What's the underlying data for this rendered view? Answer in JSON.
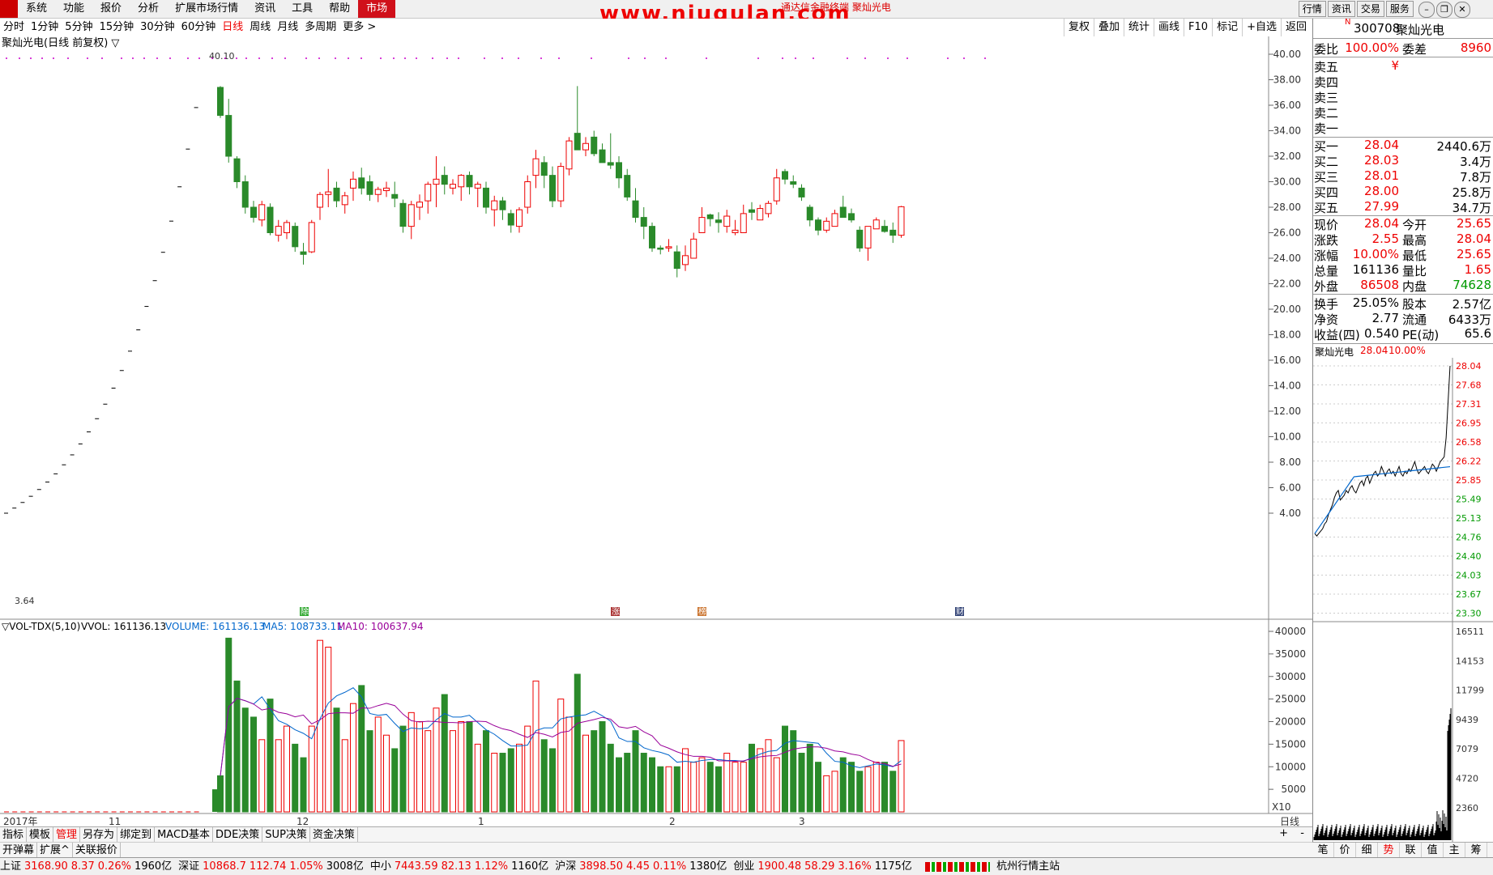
{
  "menu": {
    "items": [
      "系统",
      "功能",
      "报价",
      "分析",
      "扩展市场行情",
      "资讯",
      "工具",
      "帮助"
    ],
    "market_label": "市场"
  },
  "watermark": {
    "main": "www.niugulan.com",
    "sub": "通达信金融终端 聚灿光电"
  },
  "top_buttons": [
    "行情",
    "资讯",
    "交易",
    "服务"
  ],
  "period_bar": {
    "items": [
      "分时",
      "1分钟",
      "5分钟",
      "15分钟",
      "30分钟",
      "60分钟",
      "日线",
      "周线",
      "月线",
      "多周期",
      "更多 >"
    ],
    "selected": "日线"
  },
  "right_tools": [
    "复权",
    "叠加",
    "统计",
    "画线",
    "F10",
    "标记",
    "+自选",
    "返回"
  ],
  "chart": {
    "title": "聚灿光电(日线 前复权) ▽",
    "max_label": "40.10",
    "min_label": "3.64",
    "markers": [
      "除",
      "涨",
      "榜",
      "财"
    ],
    "volume_header": {
      "name": "▽VOL-TDX(5,10)",
      "vvol": "VVOL: 161136.13",
      "volume": "VOLUME: 161136.13",
      "ma5": "MA5: 108733.11",
      "ma10": "MA10: 100637.94"
    },
    "x_labels": [
      "2017年",
      "11",
      "12",
      "1",
      "2",
      "3"
    ],
    "x10": "X10",
    "period_label": "日线",
    "price_ticks": [
      "40.00",
      "38.00",
      "36.00",
      "34.00",
      "32.00",
      "30.00",
      "28.00",
      "26.00",
      "24.00",
      "22.00",
      "20.00",
      "18.00",
      "16.00",
      "14.00",
      "12.00",
      "10.00",
      "8.00",
      "6.00",
      "4.00"
    ],
    "volume_ticks": [
      "40000",
      "35000",
      "30000",
      "25000",
      "20000",
      "15000",
      "10000",
      "5000"
    ]
  },
  "chart_data": {
    "type": "bar",
    "title": "聚灿光电(日线 前复权)",
    "ylim": [
      3.0,
      41.0
    ],
    "ohlc_recent": [
      [
        37.4,
        37.5,
        35.0,
        35.2
      ],
      [
        35.2,
        36.5,
        31.5,
        32.0
      ],
      [
        31.8,
        32.0,
        29.5,
        30.0
      ],
      [
        30.0,
        30.5,
        27.5,
        28.0
      ],
      [
        28.0,
        28.5,
        26.8,
        27.2
      ],
      [
        27.0,
        28.5,
        26.5,
        28.2
      ],
      [
        28.0,
        28.3,
        25.8,
        26.0
      ],
      [
        25.8,
        27.0,
        25.3,
        26.5
      ],
      [
        26.0,
        27.0,
        25.5,
        26.8
      ],
      [
        26.5,
        26.8,
        24.5,
        24.9
      ],
      [
        24.5,
        25.2,
        23.5,
        24.3
      ],
      [
        24.5,
        27.0,
        24.4,
        26.8
      ],
      [
        28.0,
        29.2,
        27.0,
        29.0
      ],
      [
        29.0,
        31.0,
        28.0,
        29.2
      ],
      [
        29.5,
        30.0,
        28.0,
        28.5
      ],
      [
        28.2,
        29.2,
        27.5,
        28.9
      ],
      [
        29.5,
        30.8,
        28.5,
        30.2
      ],
      [
        30.3,
        31.1,
        29.0,
        29.5
      ],
      [
        30.0,
        30.5,
        28.5,
        29.0
      ],
      [
        29.0,
        29.6,
        28.4,
        29.4
      ],
      [
        29.3,
        30.0,
        28.8,
        29.5
      ],
      [
        29.0,
        30.0,
        28.0,
        28.7
      ],
      [
        28.3,
        28.6,
        26.0,
        26.5
      ],
      [
        26.5,
        28.5,
        25.5,
        28.2
      ],
      [
        28.0,
        29.0,
        27.0,
        28.4
      ],
      [
        28.5,
        30.0,
        27.5,
        29.8
      ],
      [
        29.8,
        32.0,
        28.0,
        30.2
      ],
      [
        30.5,
        31.2,
        29.0,
        29.8
      ],
      [
        29.5,
        30.2,
        29.0,
        29.8
      ],
      [
        29.6,
        30.6,
        28.5,
        30.5
      ],
      [
        30.5,
        30.8,
        29.0,
        29.6
      ],
      [
        29.5,
        30.0,
        28.0,
        29.8
      ],
      [
        29.5,
        30.0,
        27.5,
        28.0
      ],
      [
        27.8,
        28.9,
        26.5,
        28.5
      ],
      [
        28.5,
        28.8,
        27.0,
        27.8
      ],
      [
        27.5,
        27.8,
        26.0,
        26.6
      ],
      [
        26.5,
        28.0,
        26.0,
        27.8
      ],
      [
        28.0,
        30.5,
        27.5,
        30.0
      ],
      [
        30.5,
        32.5,
        29.5,
        31.8
      ],
      [
        31.5,
        32.0,
        29.5,
        30.5
      ],
      [
        30.5,
        31.2,
        28.0,
        28.5
      ],
      [
        28.5,
        31.5,
        28.0,
        31.2
      ],
      [
        31.0,
        33.5,
        30.5,
        33.2
      ],
      [
        33.8,
        37.5,
        32.5,
        32.5
      ],
      [
        32.5,
        33.5,
        32.0,
        33.0
      ],
      [
        33.5,
        34.0,
        32.0,
        32.2
      ],
      [
        32.5,
        33.0,
        31.5,
        31.5
      ],
      [
        31.5,
        33.8,
        31.0,
        31.3
      ],
      [
        31.5,
        32.0,
        29.5,
        30.3
      ],
      [
        30.5,
        31.0,
        28.5,
        28.8
      ],
      [
        28.5,
        29.5,
        26.8,
        27.2
      ],
      [
        27.2,
        28.0,
        25.5,
        26.5
      ],
      [
        26.5,
        26.8,
        24.5,
        24.8
      ],
      [
        24.8,
        25.0,
        24.3,
        24.7
      ],
      [
        24.8,
        25.5,
        24.5,
        24.9
      ],
      [
        24.5,
        25.0,
        22.5,
        23.2
      ],
      [
        23.5,
        25.0,
        23.0,
        24.2
      ],
      [
        24.0,
        26.0,
        24.0,
        25.5
      ],
      [
        26.0,
        28.0,
        26.0,
        27.2
      ],
      [
        27.4,
        27.5,
        26.5,
        27.1
      ],
      [
        27.0,
        27.6,
        26.0,
        26.8
      ],
      [
        26.5,
        27.8,
        26.0,
        27.3
      ],
      [
        26.0,
        27.0,
        25.8,
        26.2
      ],
      [
        26.0,
        28.2,
        26.0,
        27.5
      ],
      [
        27.8,
        28.4,
        27.0,
        27.6
      ],
      [
        27.0,
        28.2,
        27.0,
        27.9
      ],
      [
        27.5,
        28.5,
        27.2,
        28.3
      ],
      [
        28.5,
        31.0,
        28.2,
        30.3
      ],
      [
        30.8,
        31.0,
        29.8,
        30.2
      ],
      [
        30.0,
        30.5,
        29.5,
        29.8
      ],
      [
        29.5,
        29.8,
        28.5,
        28.8
      ],
      [
        28.0,
        28.2,
        26.5,
        27.0
      ],
      [
        27.0,
        27.2,
        25.8,
        26.2
      ],
      [
        26.2,
        27.2,
        26.0,
        26.9
      ],
      [
        26.5,
        27.8,
        26.5,
        27.5
      ],
      [
        28.0,
        28.9,
        27.5,
        27.2
      ],
      [
        27.5,
        27.9,
        26.8,
        27.0
      ],
      [
        26.2,
        26.5,
        24.5,
        24.8
      ],
      [
        24.8,
        26.5,
        23.8,
        26.5
      ],
      [
        26.3,
        27.2,
        26.3,
        27.0
      ],
      [
        26.5,
        27.0,
        26.0,
        26.1
      ],
      [
        26.2,
        26.8,
        25.2,
        25.8
      ],
      [
        25.8,
        28.1,
        25.6,
        28.04
      ]
    ],
    "series": [
      {
        "values": [
          161136
        ]
      }
    ]
  },
  "stock": {
    "code": "300708",
    "name": "聚灿光电",
    "n_tag": "N",
    "weibi_label": "委比",
    "weibi": "100.00%",
    "weicha_label": "委差",
    "weicha": "8960",
    "sell": [
      {
        "label": "卖五",
        "price": "¥",
        "vol": ""
      },
      {
        "label": "卖四",
        "price": "",
        "vol": ""
      },
      {
        "label": "卖三",
        "price": "",
        "vol": ""
      },
      {
        "label": "卖二",
        "price": "",
        "vol": ""
      },
      {
        "label": "卖一",
        "price": "",
        "vol": ""
      }
    ],
    "buy": [
      {
        "label": "买一",
        "price": "28.04",
        "vol": "2440.6万"
      },
      {
        "label": "买二",
        "price": "28.03",
        "vol": "3.4万"
      },
      {
        "label": "买三",
        "price": "28.01",
        "vol": "7.8万"
      },
      {
        "label": "买四",
        "price": "28.00",
        "vol": "25.8万"
      },
      {
        "label": "买五",
        "price": "27.99",
        "vol": "34.7万"
      }
    ],
    "stats": [
      {
        "l1": "现价",
        "v1": "28.04",
        "c1": "red",
        "l2": "今开",
        "v2": "25.65",
        "c2": "red"
      },
      {
        "l1": "涨跌",
        "v1": "2.55",
        "c1": "red",
        "l2": "最高",
        "v2": "28.04",
        "c2": "red"
      },
      {
        "l1": "涨幅",
        "v1": "10.00%",
        "c1": "red",
        "l2": "最低",
        "v2": "25.65",
        "c2": "red"
      },
      {
        "l1": "总量",
        "v1": "161136",
        "c1": "",
        "l2": "量比",
        "v2": "1.65",
        "c2": "red"
      },
      {
        "l1": "外盘",
        "v1": "86508",
        "c1": "red",
        "l2": "内盘",
        "v2": "74628",
        "c2": "green"
      }
    ],
    "stats2": [
      {
        "l1": "换手",
        "v1": "25.05%",
        "l2": "股本",
        "v2": "2.57亿"
      },
      {
        "l1": "净资",
        "v1": "2.77",
        "l2": "流通",
        "v2": "6433万"
      },
      {
        "l1": "收益(四)",
        "v1": "0.540",
        "l2": "PE(动)",
        "v2": "65.6"
      }
    ],
    "mini_header": {
      "name": "聚灿光电",
      "price": "28.04",
      "pct": "10.00%"
    },
    "mini_price_ticks": [
      "28.04",
      "27.68",
      "27.31",
      "26.95",
      "26.58",
      "26.22",
      "25.85",
      "25.49",
      "25.13",
      "24.76",
      "24.40",
      "24.03",
      "23.67",
      "23.30"
    ],
    "mini_vol_ticks": [
      "16511",
      "14153",
      "11799",
      "9439",
      "7079",
      "4720",
      "2360"
    ]
  },
  "bottom_tabs1": [
    "指标",
    "模板",
    "管理",
    "另存为",
    "绑定到",
    "MACD基本",
    "DDE决策",
    "SUP决策",
    "资金决策"
  ],
  "bottom_tabs1_selected": "管理",
  "bottom_tabs2": [
    "开弹幕",
    "扩展^",
    "关联报价"
  ],
  "right_tabs": [
    "笔",
    "价",
    "细",
    "势",
    "联",
    "值",
    "主",
    "筹"
  ],
  "right_tabs_selected": "势",
  "status": {
    "items": [
      {
        "name": "上证",
        "val": "3168.90",
        "chg": "8.37",
        "pct": "0.26%",
        "amt": "1960亿"
      },
      {
        "name": "深证",
        "val": "10868.7",
        "chg": "112.74",
        "pct": "1.05%",
        "amt": "3008亿"
      },
      {
        "name": "中小",
        "val": "7443.59",
        "chg": "82.13",
        "pct": "1.12%",
        "amt": "1160亿"
      },
      {
        "name": "沪深",
        "val": "3898.50",
        "chg": "4.45",
        "pct": "0.11%",
        "amt": "1380亿"
      },
      {
        "name": "创业",
        "val": "1900.48",
        "chg": "58.29",
        "pct": "3.16%",
        "amt": "1175亿"
      }
    ],
    "station": "杭州行情主站"
  }
}
